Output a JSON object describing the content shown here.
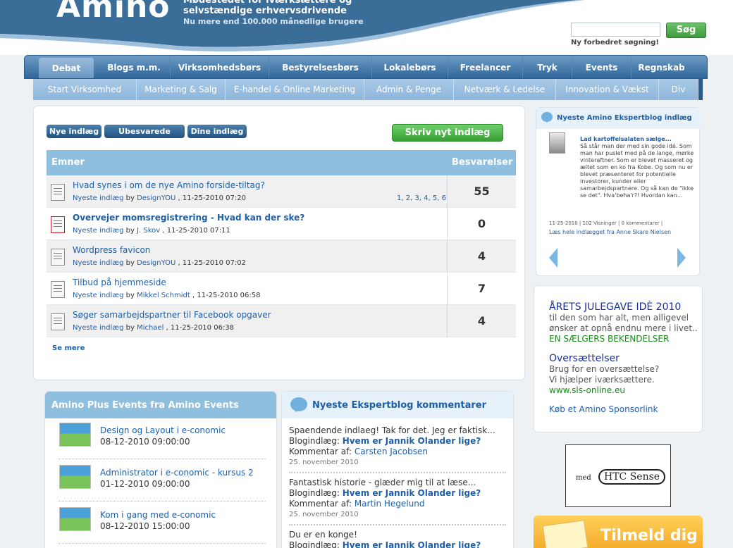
{
  "header": {
    "logo": "Amino",
    "tagline_1": "Mødestedet for iværksættere og",
    "tagline_2": "selvstændige erhvervsdrivende",
    "tagline_3": "Nu mere end 100.000 månedlige brugere",
    "search_placeholder": "",
    "search_button": "Søg",
    "search_hint": "Ny forbedret søgning!"
  },
  "main_nav": [
    "Debat",
    "Blogs m.m.",
    "Virksomhedsbørs",
    "Bestyrelsesbørs",
    "Lokalebørs",
    "Freelancer",
    "Tryk",
    "Events",
    "Regnskab"
  ],
  "sub_nav": [
    "Start Virksomhed",
    "Marketing & Salg",
    "E-handel & Online Marketing",
    "Admin & Penge",
    "Netværk & Ledelse",
    "Innovation & Vækst",
    "Div"
  ],
  "forum": {
    "buttons": [
      "Nye indlæg",
      "Ubesvarede indlæg",
      "Dine indlæg"
    ],
    "new_post": "Skriv nyt indlæg",
    "col_topics": "Emner",
    "col_replies": "Besvarelser",
    "latest_label": "Nyeste indlæg",
    "by": "by",
    "rows": [
      {
        "title": "Hvad synes i om de nye Amino forside-tiltag?",
        "author": "DesignYOU",
        "date": ", 11-25-2010 07:20",
        "pages": "1, 2, 3, 4, 5, 6",
        "count": "55"
      },
      {
        "title": "Overvejer momsregistrering - Hvad kan der ske?",
        "author": "J. Skov",
        "date": ", 11-25-2010 07:11",
        "pages": "",
        "count": "0"
      },
      {
        "title": "Wordpress favicon",
        "author": "DesignYOU",
        "date": ", 11-25-2010 07:02",
        "pages": "",
        "count": "4"
      },
      {
        "title": "Tilbud på hjemmeside",
        "author": "Mikkel Schmidt",
        "date": ", 11-25-2010 06:58",
        "pages": "",
        "count": "7"
      },
      {
        "title": "Søger samarbejdspartner til Facebook opgaver",
        "author": "Michael",
        "date": ", 11-25-2010 06:38",
        "pages": "",
        "count": "4"
      }
    ],
    "see_more": "Se mere"
  },
  "events": {
    "title": "Amino Plus Events fra Amino Events",
    "items": [
      {
        "name": "Design og Layout i e-conomic",
        "date": "08-12-2010 09:00:00"
      },
      {
        "name": "Administrator i e-conomic - kursus 2",
        "date": "01-12-2010 09:00:00"
      },
      {
        "name": "Kom i gang med e-conomic",
        "date": "08-12-2010 15:00:00"
      }
    ]
  },
  "comments": {
    "title": "Nyeste Ekspertblog kommentarer",
    "blog_label": "Blogindlæg:",
    "author_label": "Kommentar af:",
    "items": [
      {
        "text": "Spaendende indlaeg! Tak for det. Jeg er faktisk...",
        "post": "Hvem er Jannik Olander lige?",
        "author": "Carsten Jacobsen",
        "date": "25. november 2010"
      },
      {
        "text": "Fantastisk historie - glæder mig til at læse...",
        "post": "Hvem er Jannik Olander lige?",
        "author": "Martin Hegelund",
        "date": "25. november 2010"
      },
      {
        "text": "Du er en konge!",
        "post": "Hvem er Jannik Olander lige?",
        "author": "",
        "date": ""
      }
    ]
  },
  "expert": {
    "title": "Nyeste Amino Ekspertblog indlæg",
    "post_title": "Lad kartoffelsalaten sælge...",
    "body": "Så står man der med sin gode idé. Som man har puslet med på de lange, mørke vinteraftner. Som er blevet masseret og æltet som en ko fra Kobe. Og som nu er blevet præsenteret for potentielle investorer, kunder eller samarbejdspartnere. Og så kan de \"ikke se det\". Hva'beha'r?! Hvordan kan...",
    "meta": "11-25-2010 | 102 Visninger | 0 kommentarer |",
    "read_link": "Læs hele indlægget fra Anne Skare Nielsen"
  },
  "ads": [
    {
      "title": "ÅRETS JULEGAVE IDÈ 2010",
      "body_1": "til den som har alt, men alligevel",
      "body_2": "ønsker at opnå endnu mere i livet..",
      "url": "EN SÆLGERS BEKENDELSER"
    },
    {
      "title": "Oversættelser",
      "body_1": "Brug for en oversættelse?",
      "body_2": "Vi hjælper iværksættere.",
      "url": "www.sls-online.eu"
    }
  ],
  "sponsor_link": "Køb et Amino Sponsorlink",
  "htc": {
    "small": "med",
    "big": "HTC Sense"
  },
  "signup": "Tilmeld dig"
}
